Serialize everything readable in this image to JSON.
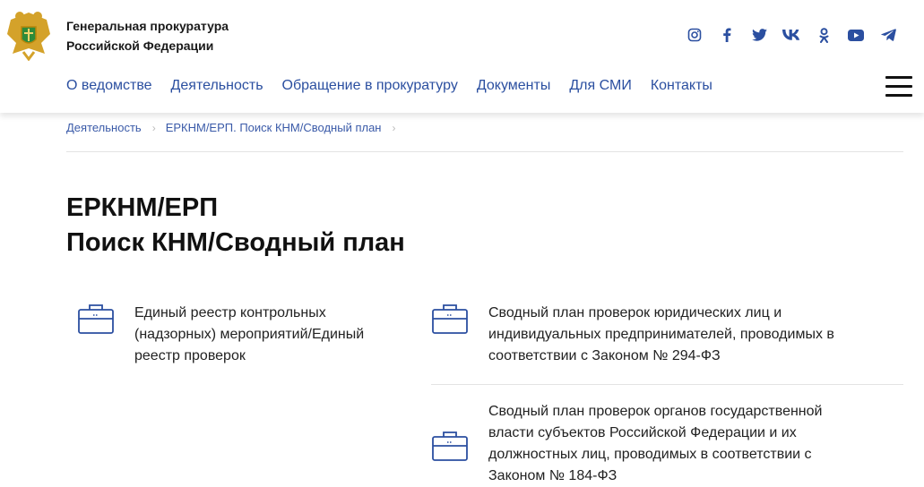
{
  "header": {
    "org_line1": "Генеральная прокуратура",
    "org_line2": "Российской Федерации",
    "socials": [
      "instagram-icon",
      "facebook-icon",
      "twitter-icon",
      "vk-icon",
      "odnoklassniki-icon",
      "youtube-icon",
      "telegram-icon"
    ]
  },
  "nav": {
    "items": [
      "О ведомстве",
      "Деятельность",
      "Обращение в прокуратуру",
      "Документы",
      "Для СМИ",
      "Контакты"
    ]
  },
  "breadcrumb": {
    "items": [
      "Деятельность",
      "ЕРКНМ/ЕРП. Поиск КНМ/Сводный план"
    ]
  },
  "page": {
    "title_line1": "ЕРКНМ/ЕРП",
    "title_line2": "Поиск КНМ/Сводный план"
  },
  "cards": [
    {
      "text": "Единый реестр контрольных (надзорных) мероприятий/Единый реестр проверок",
      "icon": "briefcase-icon"
    },
    {
      "text": "Сводный план проверок юридических лиц и индивидуальных предпринимателей, проводимых в соответствии с Законом № 294-ФЗ",
      "icon": "briefcase-icon"
    },
    {
      "text": "Сводный план проверок органов государственной власти субъектов Российской Федерации и их должностных лиц, проводимых в соответствии с Законом № 184-ФЗ",
      "icon": "briefcase-icon"
    }
  ],
  "colors": {
    "accent": "#2b4fa0",
    "logo_green": "#2e8b3a",
    "logo_gold": "#d4a22a"
  }
}
